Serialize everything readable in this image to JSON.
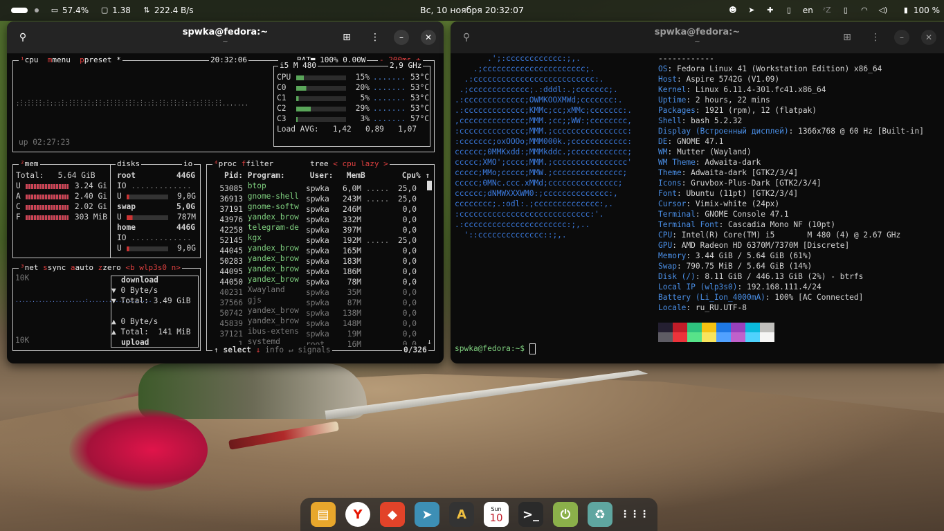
{
  "topbar": {
    "battery_pct": "57.4%",
    "load": "1.38",
    "net": "222.4 B/s",
    "clock": "Вс, 10 ноября  20:32:07",
    "lang": "en",
    "battery_right": "100 %"
  },
  "btop_window": {
    "title": "spwka@fedora:~",
    "subtitle": "~",
    "cpu_box": {
      "tabs": [
        "cpu",
        "menu",
        "preset *"
      ],
      "time": "20:32:06",
      "battery": "BAT■ 100% 0.00W",
      "interval": "- 200ms +",
      "model": "i5 M 480",
      "freq": "2,9 GHz",
      "uptime": "up 02:27:23",
      "cores": [
        {
          "name": "CPU",
          "pct": "15%",
          "temp": "53°C",
          "fill": 0.15
        },
        {
          "name": "C0",
          "pct": "20%",
          "temp": "53°C",
          "fill": 0.2
        },
        {
          "name": "C1",
          "pct": "5%",
          "temp": "53°C",
          "fill": 0.05
        },
        {
          "name": "C2",
          "pct": "29%",
          "temp": "53°C",
          "fill": 0.29
        },
        {
          "name": "C3",
          "pct": "3%",
          "temp": "57°C",
          "fill": 0.03
        }
      ],
      "load_avg": "Load AVG:   1,42   0,89   1,07"
    },
    "mem_box": {
      "title": "mem",
      "total": "Total:   5.64 GiB",
      "rows": [
        {
          "k": "U",
          "v": "3.24 Gi"
        },
        {
          "k": "A",
          "v": "2.40 Gi"
        },
        {
          "k": "C",
          "v": "2.02 Gi"
        },
        {
          "k": "F",
          "v": "303 MiB"
        }
      ]
    },
    "disks_box": {
      "title": "disks",
      "io": "io",
      "root_label": "root",
      "root_size": "446G",
      "io_label": "IO",
      "root_used": "9,0G",
      "swap_label": "swap",
      "swap_size": "5,0G",
      "swap_used": "787M",
      "home_label": "home",
      "home_size": "446G",
      "home_io": "IO",
      "home_used": "9,0G",
      "u_label": "U"
    },
    "net_box": {
      "tabs": [
        "net",
        "sync",
        "auto",
        "zero",
        "<b wlp3s0 n>"
      ],
      "scale_top": "10K",
      "scale_bottom": "10K",
      "download": "download",
      "down_rate": "▼ 0 Byte/s",
      "down_total": "▼ Total: 3.49 GiB",
      "up_rate": "▲ 0 Byte/s",
      "up_total": "▲ Total:  141 MiB",
      "upload": "upload"
    },
    "proc_box": {
      "tabs": [
        "proc",
        "filter",
        "tree",
        "< cpu lazy >"
      ],
      "headers": {
        "pid": "Pid:",
        "prog": "Program:",
        "user": "User:",
        "mem": "MemB",
        "cpu": "Cpu%"
      },
      "rows": [
        {
          "pid": "53085",
          "prog": "btop",
          "user": "spwka",
          "mem": "6,0M",
          "cpu": "25,0"
        },
        {
          "pid": "36913",
          "prog": "gnome-shell",
          "user": "spwka",
          "mem": "243M",
          "cpu": "25,0"
        },
        {
          "pid": "37191",
          "prog": "gnome-softw",
          "user": "spwka",
          "mem": "246M",
          "cpu": "0,0"
        },
        {
          "pid": "43976",
          "prog": "yandex_brow",
          "user": "spwka",
          "mem": "332M",
          "cpu": "0,0"
        },
        {
          "pid": "42258",
          "prog": "telegram-de",
          "user": "spwka",
          "mem": "397M",
          "cpu": "0,0"
        },
        {
          "pid": "52145",
          "prog": "kgx",
          "user": "spwka",
          "mem": "192M",
          "cpu": "25,0"
        },
        {
          "pid": "44045",
          "prog": "yandex_brow",
          "user": "spwka",
          "mem": "165M",
          "cpu": "0,0"
        },
        {
          "pid": "50283",
          "prog": "yandex_brow",
          "user": "spwka",
          "mem": "183M",
          "cpu": "0,0"
        },
        {
          "pid": "44095",
          "prog": "yandex_brow",
          "user": "spwka",
          "mem": "186M",
          "cpu": "0,0"
        },
        {
          "pid": "44050",
          "prog": "yandex_brow",
          "user": "spwka",
          "mem": "78M",
          "cpu": "0,0"
        },
        {
          "pid": "40231",
          "prog": "Xwayland",
          "user": "spwka",
          "mem": "35M",
          "cpu": "0,0"
        },
        {
          "pid": "37566",
          "prog": "gjs",
          "user": "spwka",
          "mem": "87M",
          "cpu": "0,0"
        },
        {
          "pid": "50742",
          "prog": "yandex_brow",
          "user": "spwka",
          "mem": "138M",
          "cpu": "0,0"
        },
        {
          "pid": "45839",
          "prog": "yandex_brow",
          "user": "spwka",
          "mem": "148M",
          "cpu": "0,0"
        },
        {
          "pid": "37121",
          "prog": "ibus-extens",
          "user": "spwka",
          "mem": "19M",
          "cpu": "0,0"
        },
        {
          "pid": "1",
          "prog": "systemd",
          "user": "root",
          "mem": "16M",
          "cpu": "0,0"
        }
      ],
      "footer_select": "select",
      "footer_info": "info",
      "footer_signals": "signals",
      "count": "0/326"
    }
  },
  "neofetch_window": {
    "title": "spwka@fedora:~",
    "subtitle": "~",
    "logo": [
      "       .';:cccccccccccc:;,.",
      "    .;cccccccccccccccccccccc;.",
      "  .:cccccccccccccccccccccccccc:.",
      " .;ccccccccccccc;.:dddl:.;ccccccc;.",
      ".:ccccccccccccc;OWMKOOXMWd;ccccccc:.",
      ".:ccccccccccccc;KMMc;cc;xMMc;ccccccc:.",
      ",cccccccccccccc;MMM.;cc;;WW:;cccccccc,",
      ":cccccccccccccc;MMM.;cccccccccccccccc:",
      ":ccccccc;oxOOOo;MMM000k.;cccccccccccc:",
      "cccccc;0MMKxdd:;MMMkddc.;cccccccccccc;",
      "ccccc;XMO';cccc;MMM.;cccccccccccccccc'",
      "ccccc;MMo;ccccc;MMW.;ccccccccccccccc;",
      "ccccc;0MNc.ccc.xMMd;ccccccccccccccc;",
      "cccccc;dNMWXXXWM0:;cccccccccccccc:,",
      "cccccccc;.:odl:.;cccccccccccccc:,.",
      ":cccccccccccccccccccccccccccc:'.",
      ".:cccccccccccccccccccccc:;,..",
      "  '::cccccccccccccc::;,."
    ],
    "separator": "------------",
    "info": [
      {
        "k": "OS",
        "v": "Fedora Linux 41 (Workstation Edition) x86_64"
      },
      {
        "k": "Host",
        "v": "Aspire 5742G (V1.09)"
      },
      {
        "k": "Kernel",
        "v": "Linux 6.11.4-301.fc41.x86_64"
      },
      {
        "k": "Uptime",
        "v": "2 hours, 22 mins"
      },
      {
        "k": "Packages",
        "v": "1921 (rpm), 12 (flatpak)"
      },
      {
        "k": "Shell",
        "v": "bash 5.2.32"
      },
      {
        "k": "Display (Встроенный дисплей)",
        "v": "1366x768 @ 60 Hz [Built-in]"
      },
      {
        "k": "DE",
        "v": "GNOME 47.1"
      },
      {
        "k": "WM",
        "v": "Mutter (Wayland)"
      },
      {
        "k": "WM Theme",
        "v": "Adwaita-dark"
      },
      {
        "k": "Theme",
        "v": "Adwaita-dark [GTK2/3/4]"
      },
      {
        "k": "Icons",
        "v": "Gruvbox-Plus-Dark [GTK2/3/4]"
      },
      {
        "k": "Font",
        "v": "Ubuntu (11pt) [GTK2/3/4]"
      },
      {
        "k": "Cursor",
        "v": "Vimix-white (24px)"
      },
      {
        "k": "Terminal",
        "v": "GNOME Console 47.1"
      },
      {
        "k": "Terminal Font",
        "v": "Cascadia Mono NF (10pt)"
      },
      {
        "k": "CPU",
        "v": "Intel(R) Core(TM) i5       M 480 (4) @ 2.67 GHz"
      },
      {
        "k": "GPU",
        "v": "AMD Radeon HD 6370M/7370M [Discrete]"
      },
      {
        "k": "Memory",
        "v": "3.44 GiB / 5.64 GiB (61%)"
      },
      {
        "k": "Swap",
        "v": "790.75 MiB / 5.64 GiB (14%)"
      },
      {
        "k": "Disk (/)",
        "v": "8.11 GiB / 446.13 GiB (2%) - btrfs"
      },
      {
        "k": "Local IP (wlp3s0)",
        "v": "192.168.111.4/24"
      },
      {
        "k": "Battery (Li_Ion_4000mA)",
        "v": "100% [AC Connected]"
      },
      {
        "k": "Locale",
        "v": "ru_RU.UTF-8"
      }
    ],
    "palette_top": [
      "#241f31",
      "#c01c28",
      "#2ec27e",
      "#f5c211",
      "#1e78e4",
      "#9841bb",
      "#0ab9dc",
      "#c0bfbc"
    ],
    "palette_bottom": [
      "#5e5c64",
      "#ed333b",
      "#57e389",
      "#f8e45c",
      "#51a1ff",
      "#c061cb",
      "#4fd2fd",
      "#f6f5f4"
    ],
    "prompt": "spwka@fedora:~$ "
  },
  "dock": {
    "apps": [
      {
        "name": "files-app",
        "glyph": "▤",
        "bg": "#e8a72c"
      },
      {
        "name": "yandex-browser-app",
        "glyph": "Y",
        "bg": "#ffffff"
      },
      {
        "name": "gitlab-app",
        "glyph": "◆",
        "bg": "#e24329"
      },
      {
        "name": "telegram-app",
        "glyph": "➤",
        "bg": "#3d8fb5"
      },
      {
        "name": "appstore-app",
        "glyph": "A",
        "bg": "#333333"
      },
      {
        "name": "calendar-app",
        "glyph": "10",
        "bg": "#ffffff"
      },
      {
        "name": "terminal-app",
        "glyph": ">_",
        "bg": "#2a2a2a"
      },
      {
        "name": "power-app",
        "glyph": "⏻",
        "bg": "#8bb04a"
      },
      {
        "name": "trash-app",
        "glyph": "♻",
        "bg": "#5fa6a0"
      },
      {
        "name": "app-grid",
        "glyph": "⋮⋮⋮",
        "bg": "transparent"
      }
    ],
    "calendar_month": "Sun",
    "calendar_day": "10"
  }
}
